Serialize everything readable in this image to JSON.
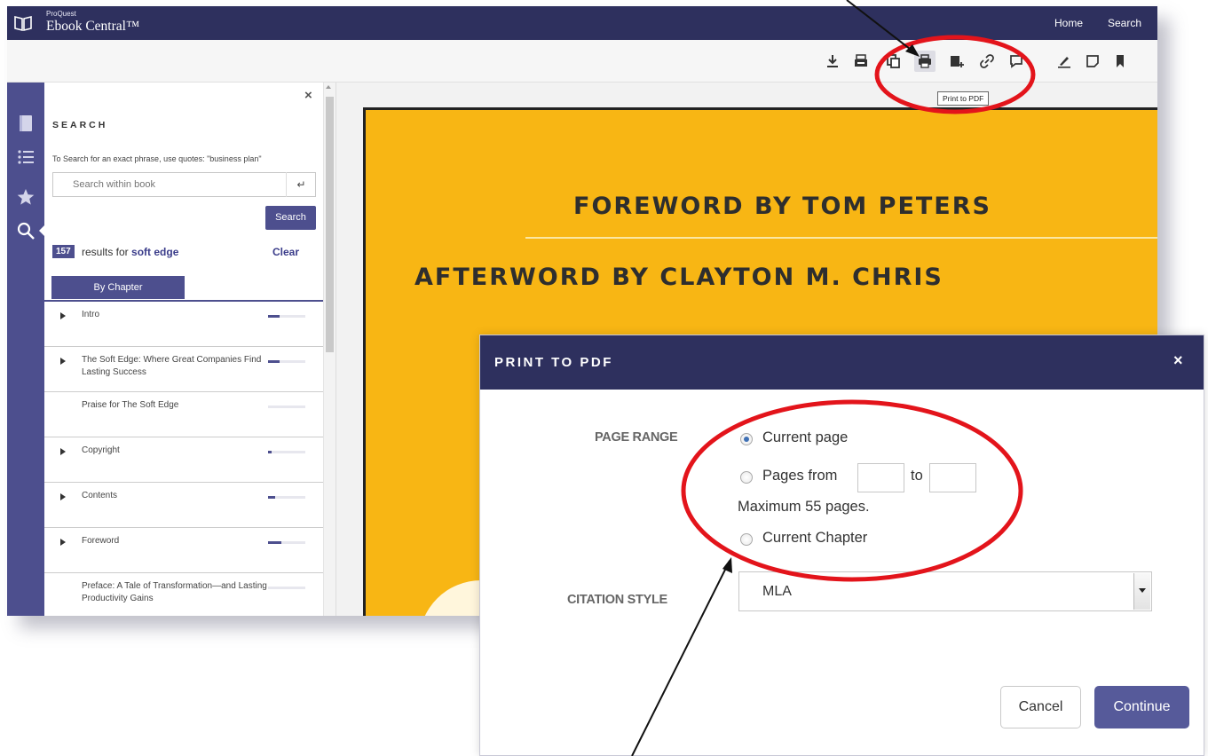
{
  "app": {
    "brand_small": "ProQuest",
    "brand_name": "Ebook Central™",
    "nav": {
      "home": "Home",
      "search": "Search"
    },
    "colors": {
      "header": "#2e305e",
      "accent": "#4d4f8e",
      "book": "#f8b614",
      "annotation": "#e3141b"
    }
  },
  "toolbar": {
    "icons": [
      "download-icon",
      "pdf-print-icon",
      "copy-icon",
      "print-icon",
      "add-to-shelf-icon",
      "link-icon",
      "share-icon",
      "highlight-icon",
      "note-icon",
      "bookmark-icon"
    ],
    "tooltip": "Print to PDF"
  },
  "rail": {
    "icons": [
      "book-icon",
      "list-icon",
      "star-icon",
      "search-icon"
    ]
  },
  "search_panel": {
    "heading": "SEARCH",
    "hint": "To Search for an exact phrase, use quotes: \"business plan\"",
    "input_placeholder": "Search within book",
    "enter_symbol": "↵",
    "search_button": "Search",
    "result_count": "157",
    "result_text": "results for",
    "result_term": "soft edge",
    "clear": "Clear",
    "tab": "By Chapter",
    "close_symbol": "×",
    "chapters": [
      {
        "label": "Intro",
        "expandable": true,
        "match_fraction": 0.3
      },
      {
        "label": "The Soft Edge: Where Great Companies Find Lasting Success",
        "expandable": true,
        "match_fraction": 0.3
      },
      {
        "label": "Praise for The Soft Edge",
        "expandable": false,
        "match_fraction": 0
      },
      {
        "label": "Copyright",
        "expandable": true,
        "match_fraction": 0.1
      },
      {
        "label": "Contents",
        "expandable": true,
        "match_fraction": 0.2
      },
      {
        "label": "Foreword",
        "expandable": true,
        "match_fraction": 0.35
      },
      {
        "label": "Preface: A Tale of Transformation—and Lasting Productivity Gains",
        "expandable": false,
        "match_fraction": 0
      }
    ]
  },
  "book_page": {
    "line1": "FOREWORD BY TOM PETERS",
    "line2": "AFTERWORD BY CLAYTON M. CHRIS"
  },
  "dialog": {
    "title": "PRINT TO PDF",
    "close_symbol": "×",
    "page_range_label": "PAGE RANGE",
    "option_current_page": "Current page",
    "option_pages_from": "Pages from",
    "to_label": "to",
    "from_value": "",
    "to_value": "",
    "max_pages": "Maximum 55 pages.",
    "option_current_chapter": "Current Chapter",
    "selected_range": "Current page",
    "citation_label": "CITATION STYLE",
    "citation_value": "MLA",
    "cancel": "Cancel",
    "continue": "Continue"
  }
}
